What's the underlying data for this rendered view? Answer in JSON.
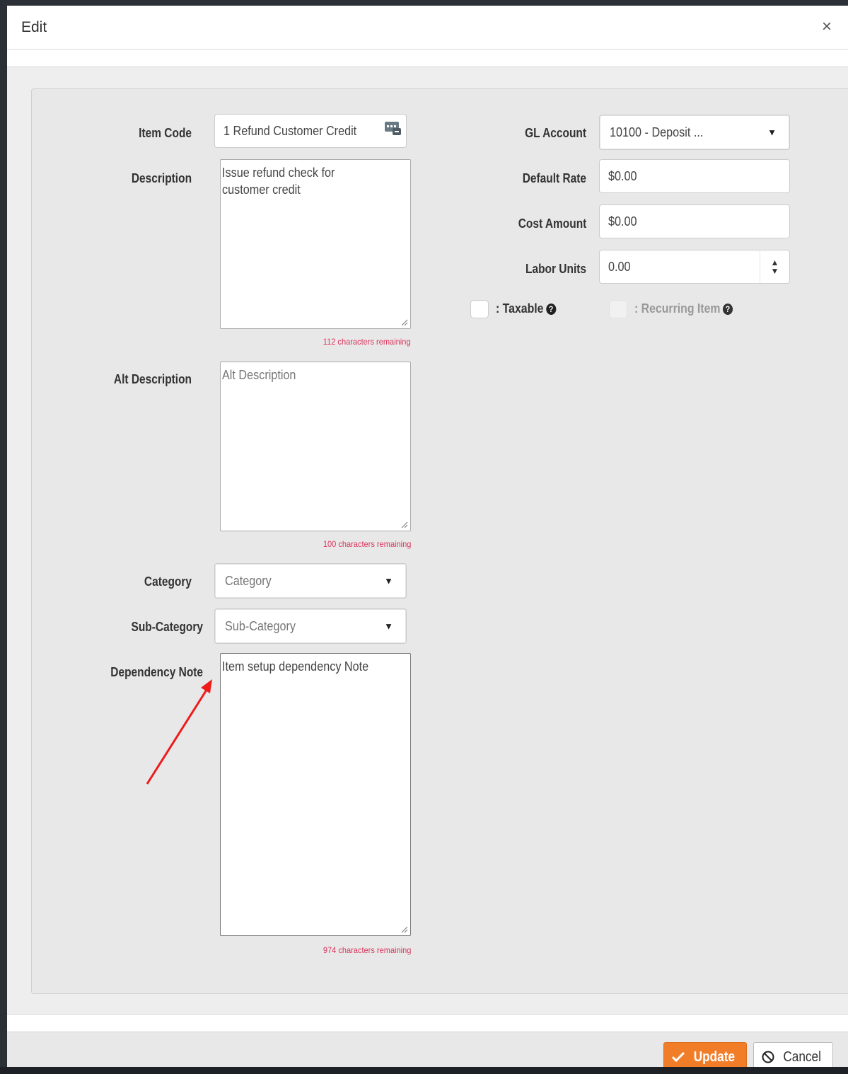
{
  "dialog": {
    "title": "Edit",
    "close_symbol": "×"
  },
  "form": {
    "item_code": {
      "label": "Item Code",
      "value": "1 Refund Customer Credit",
      "icon": "code-lookup-icon"
    },
    "description": {
      "label": "Description",
      "value": "Issue refund check for\ncustomer credit",
      "remaining": "112 characters remaining"
    },
    "alt_description": {
      "label": "Alt Description",
      "placeholder": "Alt Description",
      "remaining": "100 characters remaining"
    },
    "category": {
      "label": "Category",
      "placeholder": "Category"
    },
    "sub_category": {
      "label": "Sub-Category",
      "placeholder": "Sub-Category"
    },
    "dependency_note": {
      "label": "Dependency Note",
      "value": "Item setup dependency Note",
      "remaining": "974 characters remaining"
    },
    "gl_account": {
      "label": "GL Account",
      "value": "10100 - Deposit ..."
    },
    "default_rate": {
      "label": "Default Rate",
      "value": "$0.00"
    },
    "cost_amount": {
      "label": "Cost Amount",
      "value": "$0.00"
    },
    "labor_units": {
      "label": "Labor Units",
      "value": "0.00"
    },
    "taxable": {
      "label": ": Taxable",
      "checked": false,
      "help_icon": "question-circle-icon"
    },
    "recurring_item": {
      "label": ": Recurring Item",
      "checked": false,
      "disabled": true,
      "help_icon": "question-circle-icon"
    }
  },
  "footer": {
    "update_label": "Update",
    "cancel_label": "Cancel"
  },
  "annotation": {
    "color": "#ee1b1b",
    "icon": "red-arrow-annotation"
  },
  "colors": {
    "update_button": "#f27d29",
    "remaining_text": "#d9345b"
  }
}
